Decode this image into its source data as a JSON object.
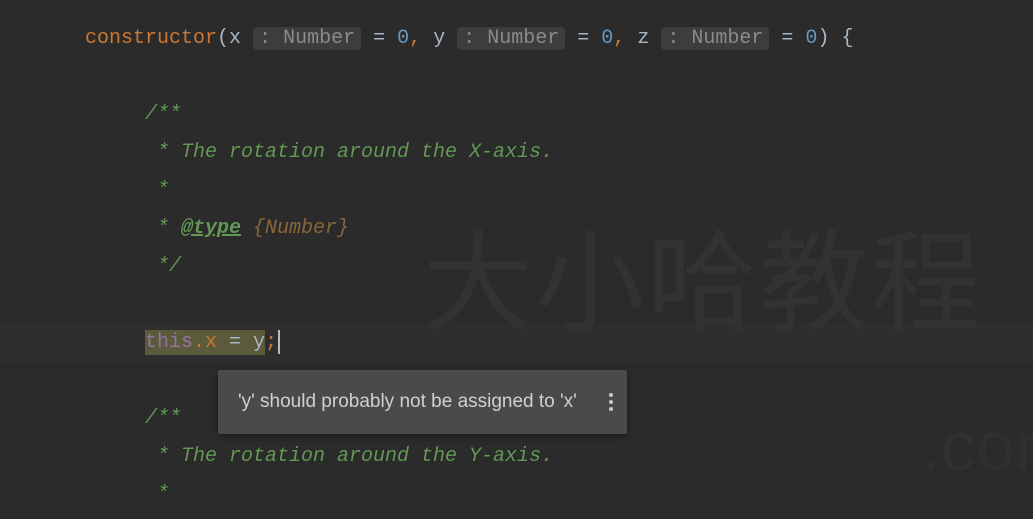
{
  "signature": {
    "keyword": "constructor",
    "params": [
      {
        "name": "x",
        "hint": ": Number",
        "default": "0"
      },
      {
        "name": "y",
        "hint": ": Number",
        "default": "0"
      },
      {
        "name": "z",
        "hint": ": Number",
        "default": "0"
      }
    ],
    "open_brace": "{"
  },
  "doc1": {
    "l1": "/**",
    "l2": " * The rotation around the X-axis.",
    "l3": " *",
    "l4_star": " * ",
    "l4_tag": "@type",
    "l4_type": " {Number}",
    "l5": " */"
  },
  "assign": {
    "this": "this",
    "dot_field": ".x",
    "eq": " = ",
    "rhs": "y",
    "semi": ";"
  },
  "doc2": {
    "l1": "/**",
    "l2": " * The rotation around the Y-axis.",
    "l3": " *"
  },
  "tooltip": {
    "text": "'y' should probably not be assigned to 'x'"
  },
  "watermark": "大小哈教程",
  "watermark2": ".com"
}
